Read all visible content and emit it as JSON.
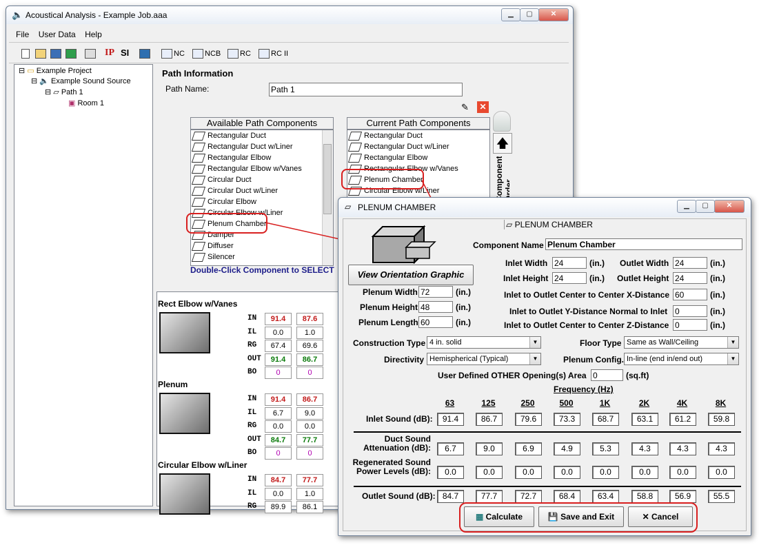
{
  "main_window": {
    "title": "Acoustical Analysis - Example Job.aaa",
    "menu": [
      "File",
      "User Data",
      "Help"
    ],
    "toolbar": {
      "ip": "IP",
      "si": "SI",
      "nc": "NC",
      "ncb": "NCB",
      "rc": "RC",
      "rc2": "RC II"
    },
    "tree": {
      "project": "Example Project",
      "source": "Example Sound Source",
      "path": "Path 1",
      "room": "Room 1"
    },
    "path_info": {
      "heading": "Path Information",
      "path_name_label": "Path Name:",
      "path_name_value": "Path 1"
    },
    "available": {
      "header": "Available Path Components",
      "items": [
        "Rectangular Duct",
        "Rectangular Duct w/Liner",
        "Rectangular Elbow",
        "Rectangular Elbow w/Vanes",
        "Circular Duct",
        "Circular Duct w/Liner",
        "Circular Elbow",
        "Circular Elbow w/Liner",
        "Plenum Chamber",
        "Damper",
        "Diffuser",
        "Silencer"
      ],
      "hint": "Double-Click Component to SELECT"
    },
    "current": {
      "header": "Current Path Components",
      "items": [
        "Rectangular Duct",
        "Rectangular Duct w/Liner",
        "Rectangular Elbow",
        "Rectangular Elbow w/Vanes",
        "Plenum Chamber",
        "Circular Elbow w/Liner"
      ],
      "order_label": "Component Order"
    },
    "row_labels": [
      "IN",
      "IL",
      "RG",
      "OUT",
      "BO"
    ],
    "components": [
      {
        "name": "Rect Elbow w/Vanes",
        "in": [
          "91.4",
          "87.6"
        ],
        "il": [
          "0.0",
          "1.0"
        ],
        "rg": [
          "67.4",
          "69.6"
        ],
        "out": [
          "91.4",
          "86.7"
        ],
        "bo": [
          "0",
          "0"
        ]
      },
      {
        "name": "Plenum",
        "in": [
          "91.4",
          "86.7"
        ],
        "il": [
          "6.7",
          "9.0"
        ],
        "rg": [
          "0.0",
          "0.0"
        ],
        "out": [
          "84.7",
          "77.7"
        ],
        "bo": [
          "0",
          "0"
        ]
      },
      {
        "name": "Circular Elbow w/Liner",
        "in": [
          "84.7",
          "77.7"
        ],
        "il": [
          "0.0",
          "1.0"
        ],
        "rg": [
          "89.9",
          "86.1"
        ]
      }
    ]
  },
  "dialog": {
    "title": "PLENUM CHAMBER",
    "tab": "PLENUM CHAMBER",
    "view_button": "View Orientation Graphic",
    "component_name_label": "Component Name",
    "component_name": "Plenum Chamber",
    "inlet_width": {
      "label": "Inlet Width",
      "value": "24",
      "unit": "(in.)"
    },
    "inlet_height": {
      "label": "Inlet Height",
      "value": "24",
      "unit": "(in.)"
    },
    "outlet_width": {
      "label": "Outlet Width",
      "value": "24",
      "unit": "(in.)"
    },
    "outlet_height": {
      "label": "Outlet Height",
      "value": "24",
      "unit": "(in.)"
    },
    "plenum_width": {
      "label": "Plenum Width",
      "value": "72",
      "unit": "(in.)"
    },
    "plenum_height": {
      "label": "Plenum Height",
      "value": "48",
      "unit": "(in.)"
    },
    "plenum_length": {
      "label": "Plenum Length",
      "value": "60",
      "unit": "(in.)"
    },
    "x_distance": {
      "label": "Inlet to Outlet Center to Center X-Distance",
      "value": "60",
      "unit": "(in.)"
    },
    "y_distance": {
      "label": "Inlet to Outlet Y-Distance Normal to Inlet",
      "value": "0",
      "unit": "(in.)"
    },
    "z_distance": {
      "label": "Inlet to Outlet Center to Center Z-Distance",
      "value": "0",
      "unit": "(in.)"
    },
    "construction_type": {
      "label": "Construction Type",
      "value": "4 in. solid"
    },
    "floor_type": {
      "label": "Floor Type",
      "value": "Same as Wall/Ceiling"
    },
    "directivity": {
      "label": "Directivity",
      "value": "Hemispherical (Typical)"
    },
    "plenum_config": {
      "label": "Plenum Config.",
      "value": "In-line (end in/end out)"
    },
    "other_opening": {
      "label": "User Defined OTHER Opening(s) Area",
      "value": "0",
      "unit": "(sq.ft)"
    },
    "frequency_label": "Frequency (Hz)",
    "frequencies": [
      "63",
      "125",
      "250",
      "500",
      "1K",
      "2K",
      "4K",
      "8K"
    ],
    "inlet_sound_label": "Inlet Sound (dB):",
    "inlet_sound": [
      "91.4",
      "86.7",
      "79.6",
      "73.3",
      "68.7",
      "63.1",
      "61.2",
      "59.8"
    ],
    "duct_atten_label1": "Duct Sound",
    "duct_atten_label2": "Attenuation (dB):",
    "duct_atten": [
      "6.7",
      "9.0",
      "6.9",
      "4.9",
      "5.3",
      "4.3",
      "4.3",
      "4.3"
    ],
    "regen_label1": "Regenerated Sound",
    "regen_label2": "Power Levels (dB):",
    "regen": [
      "0.0",
      "0.0",
      "0.0",
      "0.0",
      "0.0",
      "0.0",
      "0.0",
      "0.0"
    ],
    "outlet_sound_label": "Outlet Sound (dB):",
    "outlet_sound": [
      "84.7",
      "77.7",
      "72.7",
      "68.4",
      "63.4",
      "58.8",
      "56.9",
      "55.5"
    ],
    "buttons": {
      "calculate": "Calculate",
      "save_exit": "Save and Exit",
      "cancel": "Cancel"
    }
  }
}
